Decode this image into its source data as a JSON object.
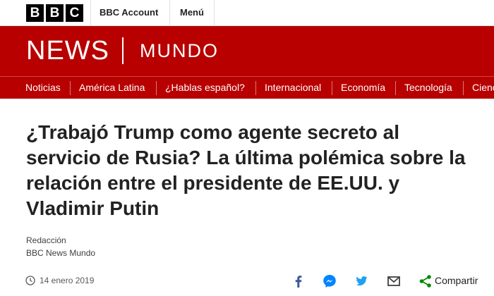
{
  "topbar": {
    "logo_letters": [
      "B",
      "B",
      "C"
    ],
    "account_label": "BBC Account",
    "menu_label": "Menú"
  },
  "masthead": {
    "brand_news": "NEWS",
    "brand_section": "MUNDO",
    "color": "#b80000"
  },
  "nav": {
    "items": [
      {
        "label": "Noticias"
      },
      {
        "label": "América Latina"
      },
      {
        "label": "¿Hablas español?"
      },
      {
        "label": "Internacional"
      },
      {
        "label": "Economía"
      },
      {
        "label": "Tecnología"
      },
      {
        "label": "Cienc"
      }
    ]
  },
  "article": {
    "headline": "¿Trabajó Trump como agente secreto al servicio de Rusia? La última polémica sobre la relación entre el presidente de EE.UU. y Vladimir Putin",
    "author": "Redacción",
    "organization": "BBC News Mundo",
    "date": "14 enero 2019"
  },
  "share": {
    "icons": [
      "facebook-icon",
      "messenger-icon",
      "twitter-icon",
      "email-icon",
      "share-icon"
    ],
    "label": "Compartir",
    "share_color": "#008a00"
  }
}
